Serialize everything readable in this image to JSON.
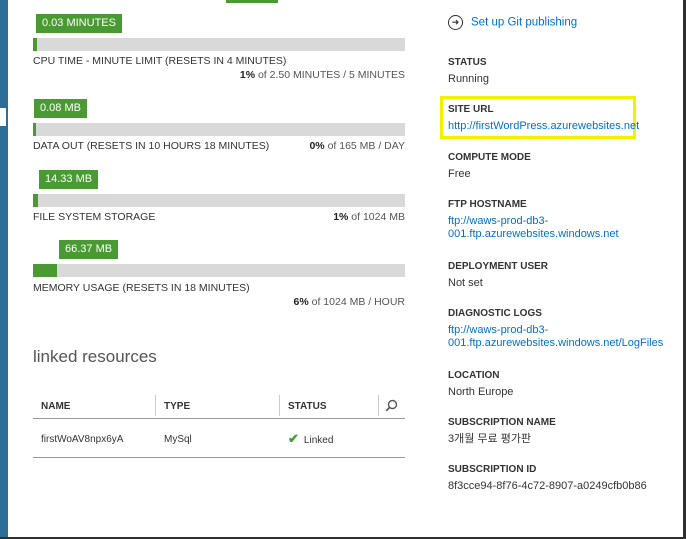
{
  "metrics": [
    {
      "bubble": "0.03 MINUTES",
      "label": "CPU TIME - MINUTE LIMIT",
      "qualifier": "(RESETS IN 4 MINUTES)",
      "percent": "1%",
      "usage": " of 2.50 MINUTES / 5 MINUTES",
      "fill": 0.01
    },
    {
      "bubble": "0.08 MB",
      "label": "DATA OUT",
      "qualifier": "(RESETS IN 10 HOURS 18 MINUTES)",
      "percent": "0%",
      "usage": " of 165 MB / DAY",
      "fill": 0.0
    },
    {
      "bubble": "14.33 MB",
      "label": "FILE SYSTEM STORAGE",
      "qualifier": "",
      "percent": "1%",
      "usage": " of 1024 MB",
      "fill": 0.014
    },
    {
      "bubble": "66.37 MB",
      "label": "MEMORY USAGE",
      "qualifier": "(RESETS IN 18 MINUTES)",
      "percent": "6%",
      "usage": " of 1024 MB / HOUR",
      "fill": 0.065
    }
  ],
  "linked": {
    "title": "linked resources",
    "columns": [
      "NAME",
      "TYPE",
      "STATUS"
    ],
    "rows": [
      {
        "name": "firstWoAV8npx6yA",
        "type": "MySql",
        "status": "Linked"
      }
    ]
  },
  "sidebar": {
    "git_link": "Set up Git publishing",
    "props": [
      {
        "key": "STATUS",
        "value": "Running",
        "link": false
      },
      {
        "key": "SITE URL",
        "value": "http://firstWordPress.azurewebsites.net",
        "link": true
      },
      {
        "key": "COMPUTE MODE",
        "value": "Free",
        "link": false
      },
      {
        "key": "FTP HOSTNAME",
        "value": "ftp://waws-prod-db3-",
        "value2": "001.ftp.azurewebsites.windows.net",
        "link": true
      },
      {
        "key": "DEPLOYMENT USER",
        "value": "Not set",
        "link": false
      },
      {
        "key": "DIAGNOSTIC LOGS",
        "value": "ftp://waws-prod-db3-",
        "value2": "001.ftp.azurewebsites.windows.net/LogFiles",
        "link": true
      },
      {
        "key": "LOCATION",
        "value": "North Europe",
        "link": false
      },
      {
        "key": "SUBSCRIPTION NAME",
        "value": "3개월 무료 평가판",
        "link": false
      },
      {
        "key": "SUBSCRIPTION ID",
        "value": "8f3cce94-8f76-4c72-8907-a0249cfb0b86",
        "link": false
      }
    ]
  },
  "colors": {
    "accent": "#4a9a33",
    "link": "#0072c6",
    "highlight": "#f2f200",
    "side": "#2b6f98"
  }
}
